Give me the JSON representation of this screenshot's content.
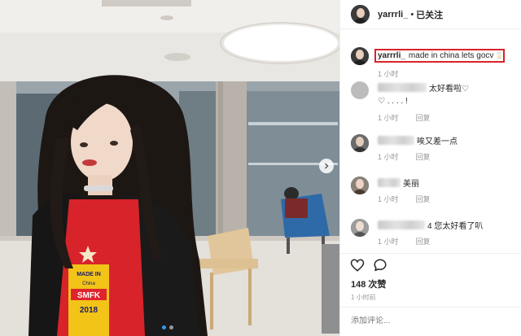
{
  "post": {
    "username": "yarrrli_",
    "separator": "•",
    "follow_status": "已关注",
    "caption_username": "yarrrli_",
    "caption_text": "made in china lets gocv",
    "caption_emoji": "🥛",
    "caption_time": "1 小时"
  },
  "comments": [
    {
      "text": "太好看啦♡",
      "extra": "♡ . . . . !",
      "time": "1 小时",
      "reply": "回复"
    },
    {
      "text": "唉又差一点",
      "time": "1 小时",
      "reply": "回复"
    },
    {
      "text": "美丽",
      "time": "1 小时",
      "reply": "回复"
    },
    {
      "text": "4 您太好看了叭",
      "time": "1 小时",
      "reply": "回复"
    }
  ],
  "actions": {
    "like_icon": "heart-icon",
    "comment_icon": "speech-bubble-icon"
  },
  "likes": "148 次赞",
  "posted_ago": "1 小时前",
  "add_comment_placeholder": "添加评论...",
  "carousel": {
    "slide_count": 2,
    "active_slide": 1,
    "next_icon": "chevron-right-icon"
  },
  "photo": {
    "shirt_print_line1": "MADE IN",
    "shirt_print_line2": "China",
    "shirt_print_line3": "SMFK",
    "shirt_print_line4": "2018"
  }
}
